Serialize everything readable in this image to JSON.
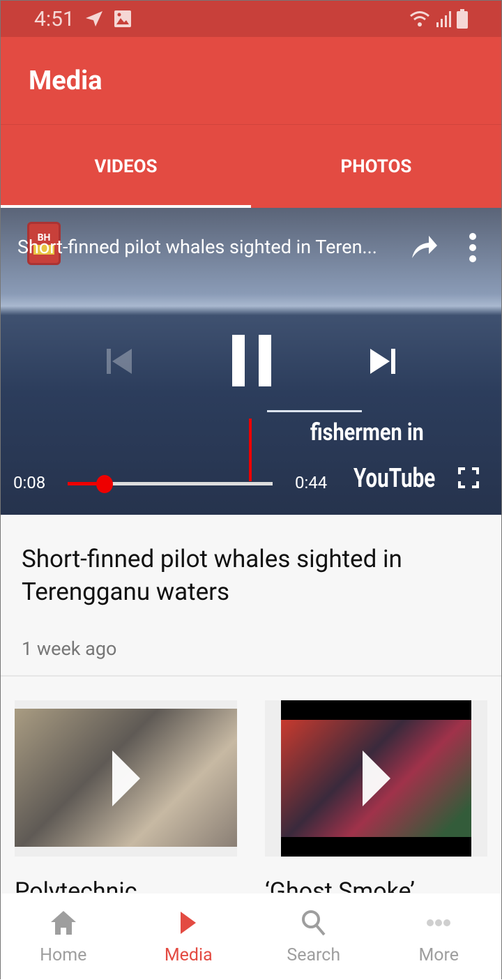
{
  "status_bar": {
    "time": "4:51"
  },
  "app_bar": {
    "title": "Media"
  },
  "tabs": [
    {
      "label": "VIDEOS",
      "active": true
    },
    {
      "label": "PHOTOS",
      "active": false
    }
  ],
  "player": {
    "channel_logo": "BH",
    "title": "Short-finned pilot whales sighted in Teren...",
    "overlay_caption": "fishermen in",
    "current_time": "0:08",
    "total_time": "0:44",
    "progress_percent": 18,
    "brand": "YouTube"
  },
  "featured": {
    "headline": "Short-finned pilot whales sighted in Terengganu waters",
    "age": "1 week ago"
  },
  "video_cards": [
    {
      "title": "Polytechnic"
    },
    {
      "title": "‘Ghost Smoke’"
    }
  ],
  "bottom_nav": [
    {
      "label": "Home",
      "icon": "home-icon",
      "active": false
    },
    {
      "label": "Media",
      "icon": "play-icon",
      "active": true
    },
    {
      "label": "Search",
      "icon": "search-icon",
      "active": false
    },
    {
      "label": "More",
      "icon": "more-icon",
      "active": false
    }
  ],
  "colors": {
    "primary": "#e34b42",
    "status_bar": "#c8403a",
    "inactive": "#9e9e9e"
  }
}
